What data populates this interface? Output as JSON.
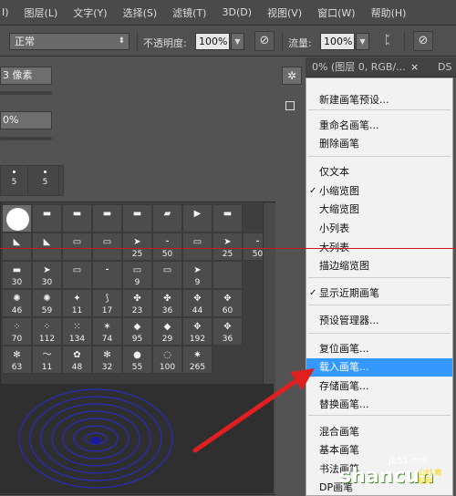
{
  "menubar": {
    "items": [
      "I)",
      "图层(L)",
      "文字(Y)",
      "选择(S)",
      "滤镜(T)",
      "3D(D)",
      "视图(V)",
      "窗口(W)",
      "帮助(H)"
    ]
  },
  "options": {
    "mode_value": "正常",
    "opacity_label": "不透明度:",
    "opacity_value": "100%",
    "flow_label": "流量:",
    "flow_value": "100%"
  },
  "panel": {
    "size_value": "3 像素",
    "hardness_value": "0%",
    "recent": [
      "5",
      "5"
    ],
    "brush_rows": [
      [
        "",
        "",
        "",
        "",
        "",
        "",
        "",
        ""
      ],
      [
        "",
        "",
        "",
        "",
        "25",
        "50",
        "",
        "25",
        "50"
      ],
      [
        "30",
        "30",
        "",
        "",
        "9",
        "",
        "9",
        ""
      ],
      [
        "46",
        "59",
        "11",
        "17",
        "23",
        "36",
        "44",
        "60"
      ],
      [
        "70",
        "112",
        "134",
        "74",
        "95",
        "29",
        "192",
        "36"
      ],
      [
        "63",
        "11",
        "48",
        "32",
        "55",
        "100",
        "265"
      ]
    ]
  },
  "tabs": {
    "doc1": "0% (图层 0, RGB/...",
    "doc2": "DS"
  },
  "menu": {
    "items": [
      {
        "label": "新建画笔预设...",
        "checked": false
      },
      {
        "label": "重命名画笔...",
        "checked": false
      },
      {
        "label": "删除画笔",
        "checked": false
      },
      {
        "label": "仅文本",
        "checked": false
      },
      {
        "label": "小缩览图",
        "checked": true
      },
      {
        "label": "大缩览图",
        "checked": false
      },
      {
        "label": "小列表",
        "checked": false
      },
      {
        "label": "大列表",
        "checked": false
      },
      {
        "label": "描边缩览图",
        "checked": false
      },
      {
        "label": "显示近期画笔",
        "checked": true
      },
      {
        "label": "预设管理器...",
        "checked": false
      },
      {
        "label": "复位画笔...",
        "checked": false
      },
      {
        "label": "载入画笔...",
        "checked": false
      },
      {
        "label": "存储画笔...",
        "checked": false
      },
      {
        "label": "替换画笔...",
        "checked": false
      },
      {
        "label": "混合画笔",
        "checked": false
      },
      {
        "label": "基本画笔",
        "checked": false
      },
      {
        "label": "书法画笔",
        "checked": false
      },
      {
        "label": "DP画笔",
        "checked": false
      }
    ],
    "check_mark": "✓"
  },
  "watermark": {
    "brand": "shancun",
    "domain": "jb51.net",
    "cn": "山村 教程网"
  },
  "colors": {
    "highlight": "#3399ff",
    "annotation_red": "#c8191f"
  }
}
